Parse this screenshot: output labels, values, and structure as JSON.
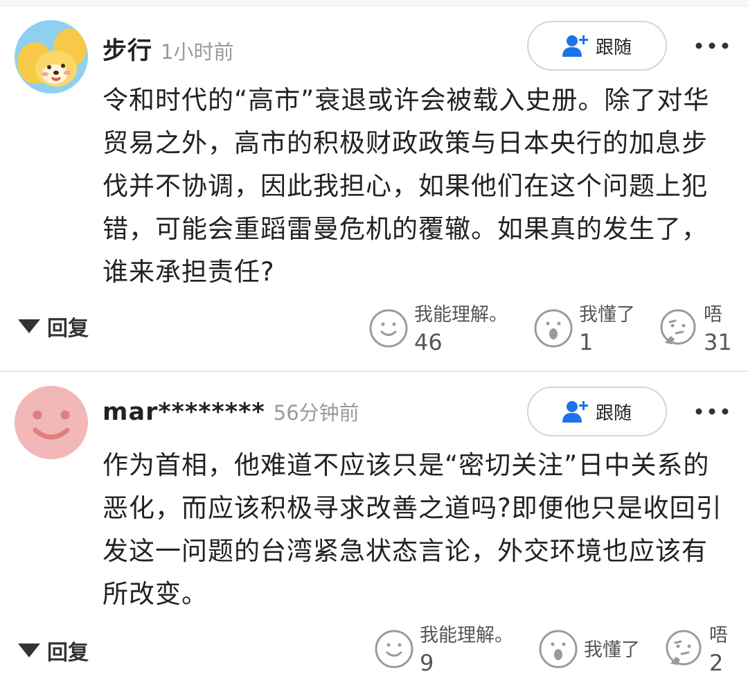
{
  "colors": {
    "accent_blue": "#1a73e8",
    "text_primary": "#222222",
    "text_secondary": "#9a9a9a",
    "icon_gray": "#8a8a8a",
    "avatar_1_bg": "#8fd0f0",
    "avatar_2_bg": "#f2b8b8"
  },
  "comments": [
    {
      "avatar_icon": "cartoon-dog-avatar",
      "username": "步行",
      "time": "1小时前",
      "follow_label": "跟随",
      "follow_icon": "add-user-icon",
      "more_icon": "more-dots-icon",
      "text": "令和时代的“高市”衰退或许会被载入史册。除了对华贸易之外，高市的积极财政政策与日本央行的加息步伐并不协调，因此我担心，如果他们在这个问题上犯错，可能会重蹈雷曼危机的覆辙。如果真的发生了，谁来承担责任?",
      "reply_label": "回复",
      "reactions": [
        {
          "icon": "smile-face-icon",
          "label": "我能理解。",
          "count": "46"
        },
        {
          "icon": "surprised-face-icon",
          "label": "我懂了",
          "count": "1"
        },
        {
          "icon": "thinking-face-icon",
          "label": "唔",
          "count": "31"
        }
      ]
    },
    {
      "avatar_icon": "smiley-avatar",
      "username": "mar********",
      "time": "56分钟前",
      "follow_label": "跟随",
      "follow_icon": "add-user-icon",
      "more_icon": "more-dots-icon",
      "text": "作为首相，他难道不应该只是“密切关注”日中关系的恶化，而应该积极寻求改善之道吗?即便他只是收回引发这一问题的台湾紧急状态言论，外交环境也应该有所改变。",
      "reply_label": "回复",
      "reactions": [
        {
          "icon": "smile-face-icon",
          "label": "我能理解。",
          "count": "9"
        },
        {
          "icon": "surprised-face-icon",
          "label": "我懂了",
          "count": ""
        },
        {
          "icon": "thinking-face-icon",
          "label": "唔",
          "count": "2"
        }
      ]
    }
  ]
}
